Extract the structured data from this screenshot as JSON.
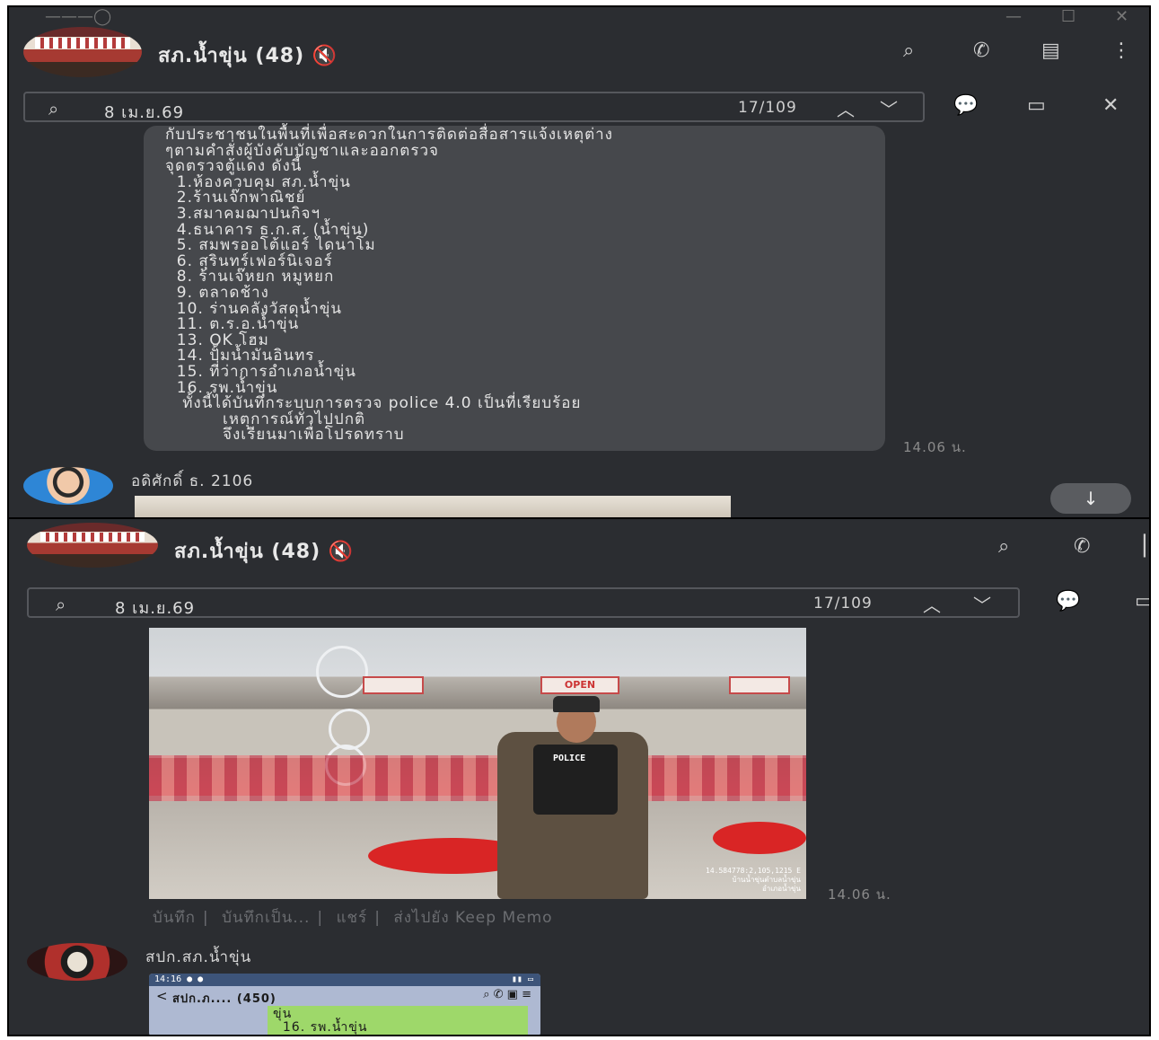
{
  "colors": {
    "panel_bg": "#2b2d31",
    "bubble_bg": "#46484c",
    "muted_text": "#8a8a8a",
    "phone_green_bubble": "#9ed86a",
    "phone_header": "#aeb9d2"
  },
  "top": {
    "header": {
      "title": "สภ.น้ำขุ่น (48)",
      "mute_icon": "muted-speaker-icon",
      "icons": [
        "search-icon",
        "phone-icon",
        "notes-icon",
        "more-vertical-icon"
      ]
    },
    "search": {
      "query": "8 เม.ย.69",
      "counter": "17/109"
    },
    "search_right_icons": [
      "chat-bubble-icon",
      "calendar-icon",
      "close-icon"
    ],
    "message": {
      "lines": [
        "กับประชาชนในพื้นที่เพื่อสะดวกในการติดต่อสื่อสารแจ้งเหตุต่าง",
        "ๆตามคำสั่งผู้บังคับบัญชาและออกตรวจ",
        "จุดตรวจตู้แดง ดังนี้",
        "  1.ห้องควบคุม สภ.น้ำขุ่น",
        "  2.ร้านเจ๊กพาณิชย์",
        "  3.สมาคมฌาปนกิจฯ",
        "  4.ธนาคาร ธ.ก.ส. (น้ำขุ่น)",
        "  5. สมพรออโต้แอร์ ไดนาโม",
        "  6. สุรินทร์เฟอร์นิเจอร์",
        "  8. ร้านเจ๊หยก หมูหยก",
        "  9. ตลาดช้าง",
        "  10. ร่านคลังวัสดุน้ำขุ่น",
        "  11. ต.ร.อ.น้ำขุ่น",
        "  13. OK โฮม",
        "  14. ปั้มน้ำมันอินทร",
        "  15. ที่ว่าการอำเภอน้ำขุ่น",
        "  16. รพ.น้ำขุ่น",
        "   ทั้งนี้ได้บันทึกระบบการตรวจ police 4.0 เป็นที่เรียบร้อย",
        "          เหตุการณ์ทั่วไปปกติ",
        "          จึงเรียนมาเพื่อโปรดทราบ"
      ],
      "time": "14.06 น."
    },
    "next_sender": "อดิศักดิ์ ธ. 2106",
    "scroll_down_icon": "arrow-down-icon"
  },
  "bottom": {
    "header": {
      "title": "สภ.น้ำขุ่น (48)",
      "mute_icon": "muted-speaker-icon",
      "icons": [
        "search-icon",
        "phone-icon"
      ]
    },
    "search": {
      "query": "8 เม.ย.69",
      "counter": "17/109"
    },
    "photo": {
      "sign_text": "OPEN",
      "vest_text": "POLICE",
      "stamp_lines": [
        "14.584778:2,105,1215 E",
        "บ้านน้ำขุ่นตำบลน้ำขุ่น",
        "อำเภอน้ำขุ่น"
      ],
      "time": "14.06 น."
    },
    "actions": [
      "บันทึก",
      "บันทึกเป็น...",
      "แชร์",
      "ส่งไปยัง Keep Memo"
    ],
    "next_sender": "สปก.สภ.น้ำขุ่น",
    "phone": {
      "status_time": "14:16",
      "title": "สปก.ภ.... (450)",
      "green_lines": [
        "ขุ่น",
        "  16. รพ.น้ำขุ่น"
      ]
    }
  }
}
